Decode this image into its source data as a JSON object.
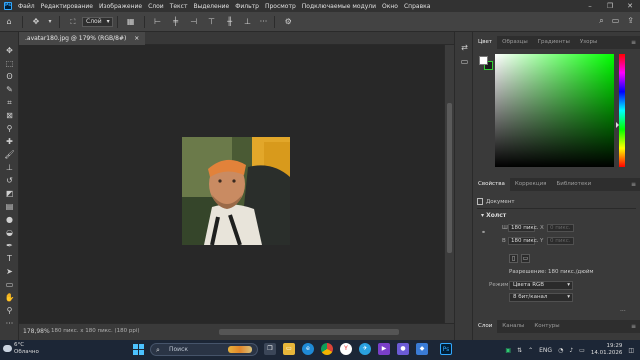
{
  "menu": {
    "logo": "Ps",
    "items": [
      "Файл",
      "Редактирование",
      "Изображение",
      "Слои",
      "Текст",
      "Выделение",
      "Фильтр",
      "Просмотр",
      "Подключаемые модули",
      "Окно",
      "Справка"
    ]
  },
  "window_controls": {
    "minimize": "–",
    "maximize": "❐",
    "close": "✕"
  },
  "options": {
    "auto_select_label": "Слой"
  },
  "document": {
    "tab_title": ".avatar180.jpg @ 179% (RGB/8#)",
    "tab_close": "×"
  },
  "status": {
    "zoom": "178,98%",
    "info": "180 пикс. x 180 пикс. (180 ppi)"
  },
  "panels": {
    "top_tabs": [
      "Цвет",
      "Образцы",
      "Градиенты",
      "Узоры"
    ],
    "props_tabs": [
      "Свойства",
      "Коррекция",
      "Библиотеки"
    ],
    "doc_label": "Документ",
    "canvas_section": "Холст",
    "w_label": "Ш",
    "h_label": "В",
    "x_label": "X",
    "y_label": "Y",
    "width_value": "180 пикс.",
    "height_value": "180 пикс.",
    "x_value": "0 пикс.",
    "y_value": "0 пикс.",
    "resolution": "Разрешение: 180 пикс./дюйм",
    "mode_label": "Режим",
    "mode_value": "Цвета RGB",
    "depth_value": "8 бит/канал",
    "bottom_tabs": [
      "Слои",
      "Каналы",
      "Контуры"
    ],
    "menu_glyph": "≡"
  },
  "taskbar": {
    "weather_temp": "6°C",
    "weather_desc": "Облачно",
    "search_placeholder": "Поиск",
    "lang": "ENG",
    "time": "19:29",
    "date": "14.01.2026"
  }
}
